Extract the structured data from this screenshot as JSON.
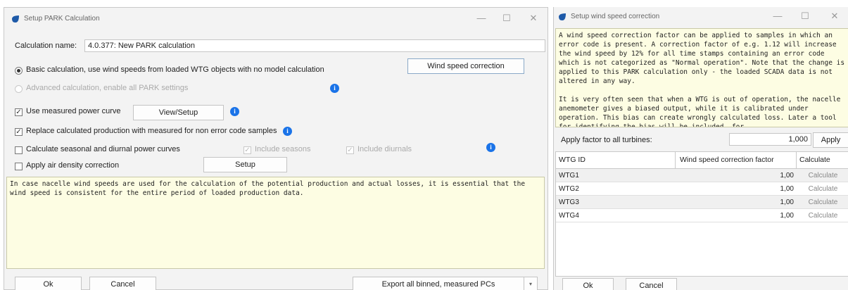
{
  "left_window": {
    "title": "Setup PARK Calculation",
    "calc_name_label": "Calculation name:",
    "calc_name_value": "4.0.377: New PARK calculation",
    "basic_calc_label": "Basic calculation, use wind speeds from loaded WTG objects with no model calculation",
    "advanced_calc_label": "Advanced calculation, enable all PARK settings",
    "wind_speed_correction_button": "Wind speed correction",
    "use_measured_pc_label": "Use measured power curve",
    "view_setup_button": "View/Setup",
    "replace_production_label": "Replace calculated production with measured for non error code samples",
    "seasonal_diurnal_label": "Calculate seasonal and diurnal power curves",
    "include_seasons_label": "Include seasons",
    "include_diurnals_label": "Include diurnals",
    "air_density_label": "Apply air density correction",
    "setup_button": "Setup",
    "note_text": "In case nacelle wind speeds are used for the calculation of the potential production and actual losses, it is essential that the wind speed is consistent for the entire period of loaded production data.",
    "ok_button": "Ok",
    "cancel_button": "Cancel",
    "export_button": "Export all binned, measured PCs"
  },
  "right_window": {
    "title": "Setup wind speed correction",
    "note_p1": "A wind speed correction factor can be applied to samples in which an error code is present. A correction factor of e.g. 1.12 will increase the wind speed by 12% for all time stamps containing an error code which is not categorized as \"Normal operation\". Note that the change is applied to this PARK calculation only - the loaded SCADA data is not altered in any way.",
    "note_p2": "It is very often seen that when a WTG is out of operation, the nacelle anemometer gives a biased output, while it is calibrated under operation. This bias can create wrongly calculated loss. Later a tool for identifying the bias will be included, for",
    "apply_factor_label": "Apply factor to all turbines:",
    "apply_factor_value": "1,000",
    "apply_button": "Apply",
    "columns": [
      "WTG ID",
      "Wind speed correction factor",
      "Calculate"
    ],
    "rows": [
      {
        "id": "WTG1",
        "factor": "1,00",
        "calc": "Calculate"
      },
      {
        "id": "WTG2",
        "factor": "1,00",
        "calc": "Calculate"
      },
      {
        "id": "WTG3",
        "factor": "1,00",
        "calc": "Calculate"
      },
      {
        "id": "WTG4",
        "factor": "1,00",
        "calc": "Calculate"
      }
    ],
    "ok_button": "Ok",
    "cancel_button": "Cancel"
  },
  "colors": {
    "info_icon": "#1a73e8",
    "note_background": "#fdfde3",
    "window_background": "#f3f3f3"
  }
}
